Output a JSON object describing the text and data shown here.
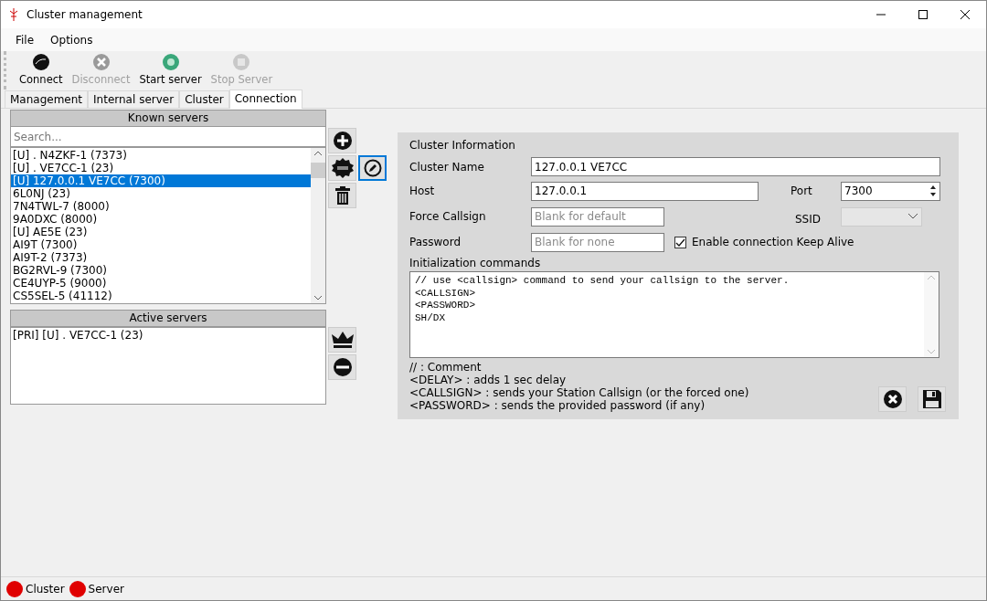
{
  "window": {
    "title": "Cluster management"
  },
  "menu": [
    "File",
    "Options"
  ],
  "toolbar": [
    {
      "kind": "connect",
      "label": "Connect",
      "disabled": false
    },
    {
      "kind": "disconnect",
      "label": "Disconnect",
      "disabled": true
    },
    {
      "kind": "start",
      "label": "Start server",
      "disabled": false
    },
    {
      "kind": "stop",
      "label": "Stop Server",
      "disabled": true
    }
  ],
  "tabs": [
    {
      "label": "Management",
      "selected": false
    },
    {
      "label": "Internal server",
      "selected": false
    },
    {
      "label": "Cluster",
      "selected": false
    },
    {
      "label": "Connection",
      "selected": true
    }
  ],
  "known_servers": {
    "title": "Known servers",
    "search": {
      "placeholder": "Search..."
    },
    "items": [
      {
        "label": "[U] . N4ZKF-1 (7373)",
        "selected": false
      },
      {
        "label": "[U] . VE7CC-1 (23)",
        "selected": false
      },
      {
        "label": "[U] 127.0.0.1 VE7CC (7300)",
        "selected": true
      },
      {
        "label": "6L0NJ (23)",
        "selected": false
      },
      {
        "label": "7N4TWL-7 (8000)",
        "selected": false
      },
      {
        "label": "9A0DXC (8000)",
        "selected": false
      },
      {
        "label": "[U] AE5E (23)",
        "selected": false
      },
      {
        "label": "AI9T (7300)",
        "selected": false
      },
      {
        "label": "AI9T-2 (7373)",
        "selected": false
      },
      {
        "label": "BG2RVL-9 (7300)",
        "selected": false
      },
      {
        "label": "CE4UYP-5 (9000)",
        "selected": false
      },
      {
        "label": "CS5SEL-5 (41112)",
        "selected": false
      }
    ]
  },
  "active_servers": {
    "title": "Active servers",
    "items": [
      {
        "label": "[PRI] [U] . VE7CC-1 (23)",
        "selected": false
      }
    ]
  },
  "cluster_info": {
    "title": "Cluster Information",
    "name": {
      "label": "Cluster Name",
      "value": "127.0.0.1 VE7CC"
    },
    "host": {
      "label": "Host",
      "value": "127.0.0.1"
    },
    "port": {
      "label": "Port",
      "value": "7300"
    },
    "force_callsign": {
      "label": "Force Callsign",
      "placeholder": "Blank for default"
    },
    "ssid": {
      "label": "SSID"
    },
    "password": {
      "label": "Password",
      "placeholder": "Blank for none"
    },
    "keep_alive": {
      "label": "Enable connection Keep Alive",
      "checked": true
    },
    "commands": {
      "label": "Initialization commands",
      "lines": [
        "// use <callsign> command to send your callsign to the server.",
        "<CALLSIGN>",
        "<PASSWORD>",
        "SH/DX"
      ]
    },
    "legend": [
      "// : Comment",
      "<DELAY> : adds 1 sec delay",
      "<CALLSIGN> : sends your Station Callsign (or the forced one)",
      "<PASSWORD> : sends the provided password (if any)"
    ]
  },
  "status_bar": [
    {
      "label": "Cluster",
      "color": "#e00000"
    },
    {
      "label": "Server",
      "color": "#e00000"
    }
  ]
}
